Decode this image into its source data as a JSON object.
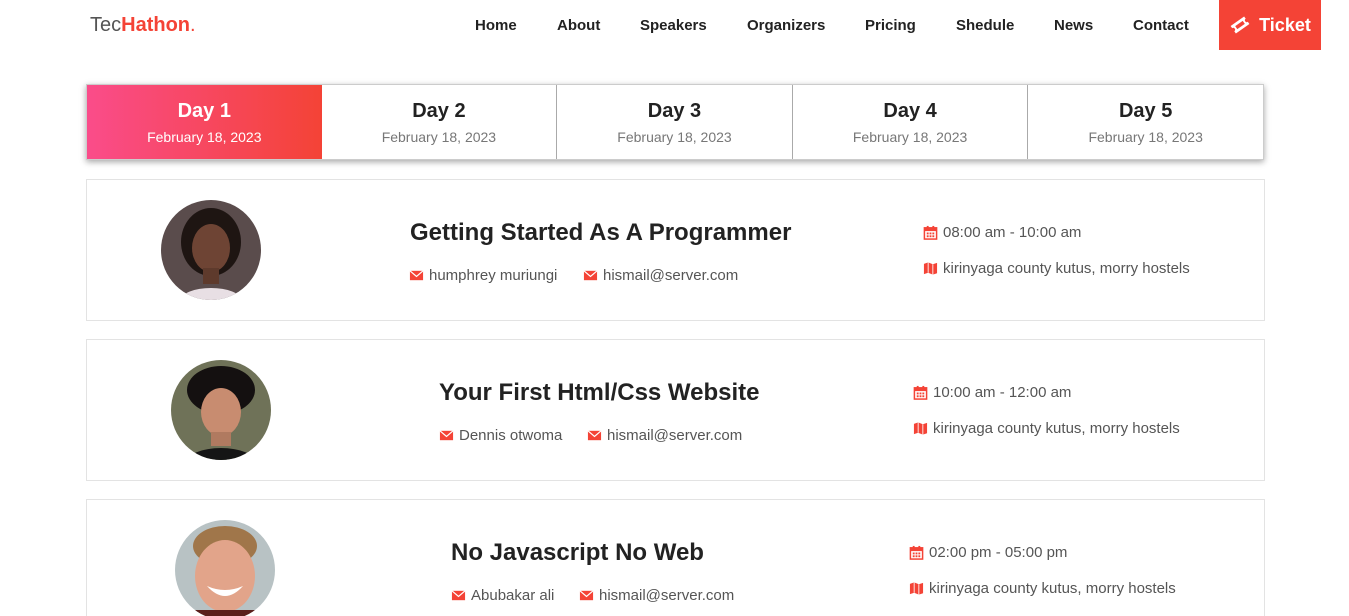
{
  "brand": {
    "prefix": "Tec",
    "accent": "Hathon",
    "suffix": "."
  },
  "nav": [
    "Home",
    "About",
    "Speakers",
    "Organizers",
    "Pricing",
    "Shedule",
    "News",
    "Contact"
  ],
  "ticket_label": "Ticket",
  "tabs": [
    {
      "day": "Day 1",
      "date": "February 18, 2023",
      "active": true
    },
    {
      "day": "Day 2",
      "date": "February 18, 2023",
      "active": false
    },
    {
      "day": "Day 3",
      "date": "February 18, 2023",
      "active": false
    },
    {
      "day": "Day 4",
      "date": "February 18, 2023",
      "active": false
    },
    {
      "day": "Day 5",
      "date": "February 18, 2023",
      "active": false
    }
  ],
  "sessions": [
    {
      "title": "Getting Started As A Programmer",
      "speaker": "humphrey muriungi",
      "email": "hismail@server.com",
      "time": "08:00 am - 10:00 am",
      "location": "kirinyaga county kutus, morry hostels"
    },
    {
      "title": "Your First Html/Css Website",
      "speaker": "Dennis otwoma",
      "email": "hismail@server.com",
      "time": "10:00 am - 12:00 am",
      "location": "kirinyaga county kutus, morry hostels"
    },
    {
      "title": "No Javascript No Web",
      "speaker": "Abubakar ali",
      "email": "hismail@server.com",
      "time": "02:00 pm - 05:00 pm",
      "location": "kirinyaga county kutus, morry hostels"
    }
  ],
  "colors": {
    "accent": "#f44336",
    "gradient_start": "#fa4c8a"
  },
  "icons": {
    "ticket": "ticket-icon",
    "email": "envelope-icon",
    "time": "calendar-icon",
    "location": "map-icon"
  }
}
